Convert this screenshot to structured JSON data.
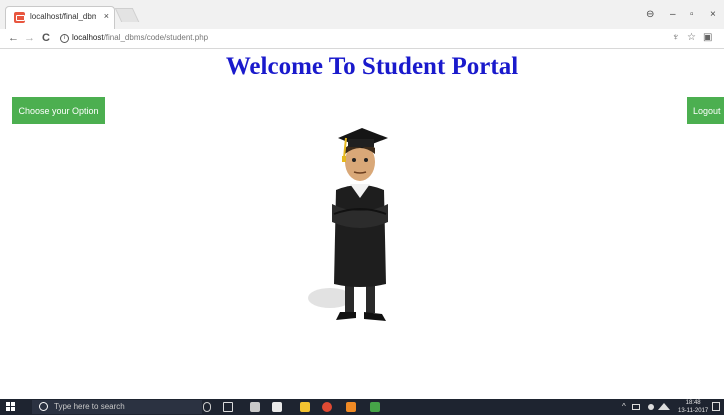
{
  "browser": {
    "tab_title": "localhost/final_dbms/co",
    "tab_close": "×",
    "nav": {
      "back": "←",
      "forward": "→",
      "reload": "C"
    },
    "url_host": "localhost",
    "url_path": "/final_dbms/code/student.php",
    "window": {
      "profile": "⊖",
      "minimize": "–",
      "restore": "▫",
      "close": "×"
    },
    "toolbar": {
      "extension": "♆",
      "star": "☆",
      "menu": "▣"
    }
  },
  "page": {
    "title": "Welcome To Student Portal",
    "choose_option_label": "Choose your Option",
    "logout_label": "Logout"
  },
  "taskbar": {
    "search_placeholder": "Type here to search",
    "clock_time": "18:48",
    "clock_date": "13-11-2017"
  },
  "colors": {
    "title": "#1a1acc",
    "button": "#4caf50",
    "taskbar": "#1e2430"
  },
  "icons": [
    "favicon-icon",
    "info-icon",
    "graduate-illustration",
    "windows-start-icon",
    "search-icon"
  ]
}
